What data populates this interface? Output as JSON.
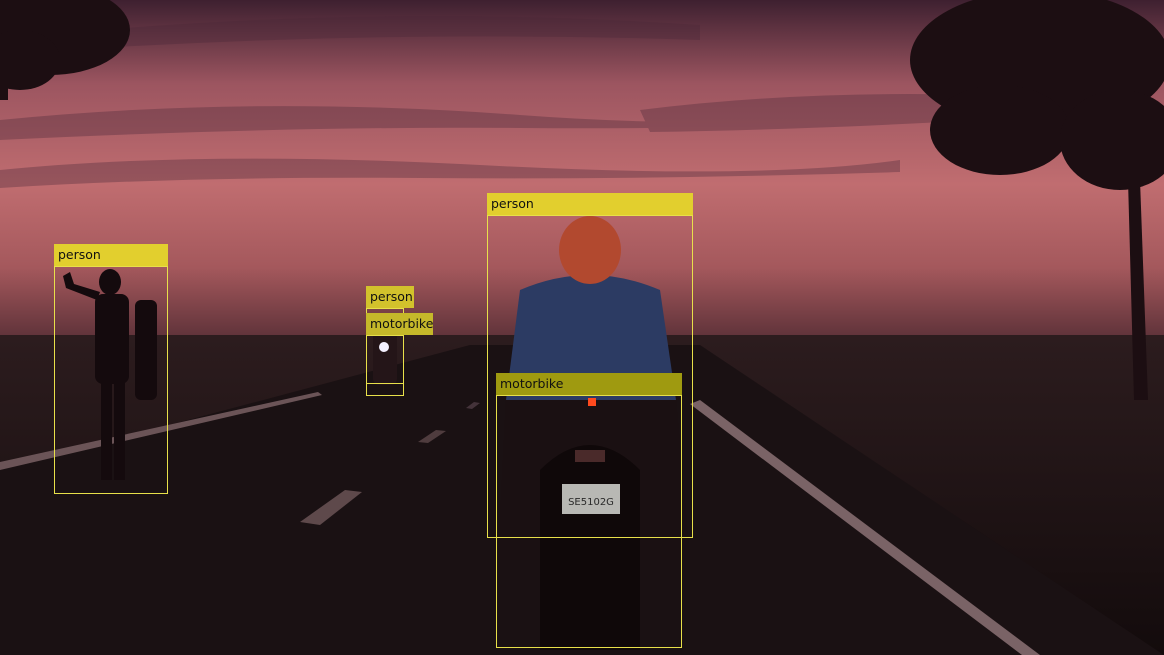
{
  "detections": [
    {
      "label": "person",
      "color": "#e2cf2e"
    },
    {
      "label": "person",
      "color": "#d2c22c"
    },
    {
      "label": "motorbike",
      "color": "#c5b82a"
    },
    {
      "label": "person",
      "color": "#e2cf2e"
    },
    {
      "label": "motorbike",
      "color": "#9f9a10"
    }
  ],
  "plate_text": "SE5102G"
}
